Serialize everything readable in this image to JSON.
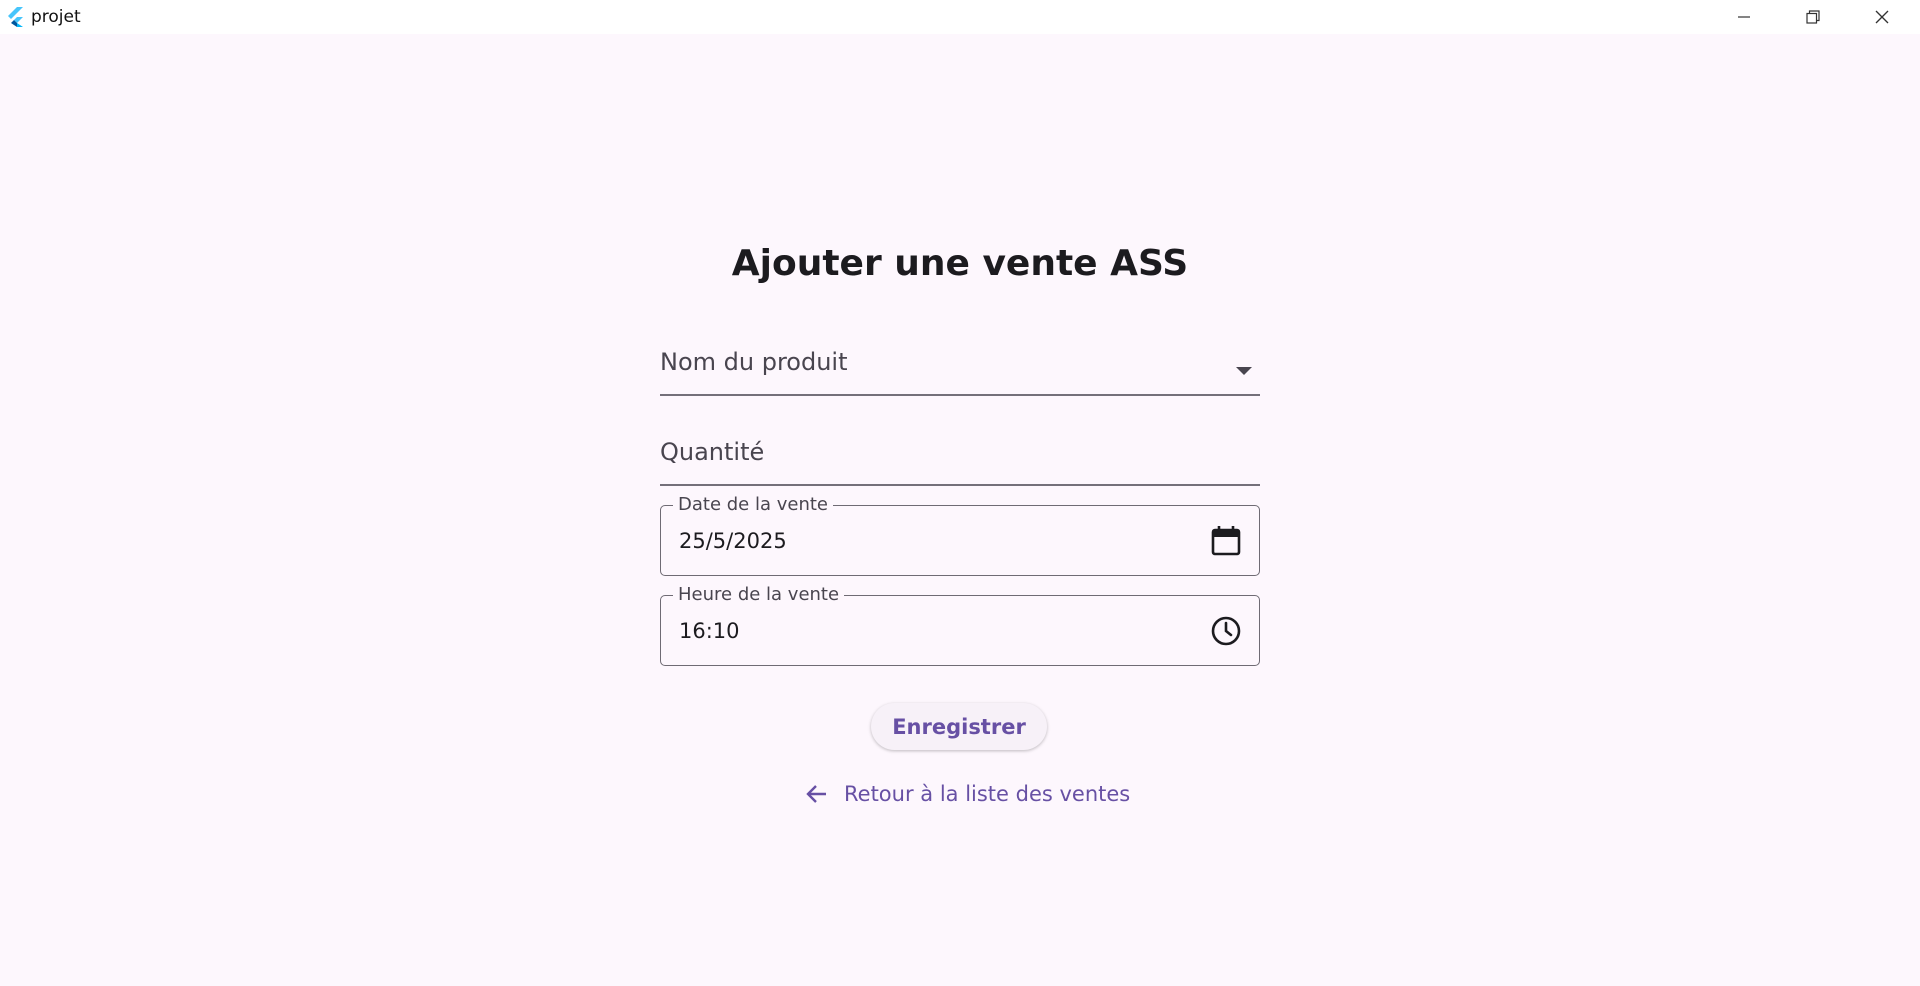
{
  "window": {
    "title": "projet",
    "controls": [
      "minimize",
      "maximize",
      "close"
    ]
  },
  "page": {
    "title": "Ajouter une vente ASS"
  },
  "form": {
    "product": {
      "label": "Nom du produit",
      "value": ""
    },
    "quantity": {
      "label": "Quantité",
      "value": ""
    },
    "date": {
      "label": "Date de la vente",
      "value": "25/5/2025",
      "icon": "calendar-icon"
    },
    "time": {
      "label": "Heure de la vente",
      "value": "16:10",
      "icon": "clock-icon"
    }
  },
  "actions": {
    "save_label": "Enregistrer",
    "back_label": "Retour à la liste des ventes"
  },
  "colors": {
    "background": "#fdf7fd",
    "accent": "#6750a4",
    "text": "#1c1b1f",
    "label": "#49454f"
  }
}
